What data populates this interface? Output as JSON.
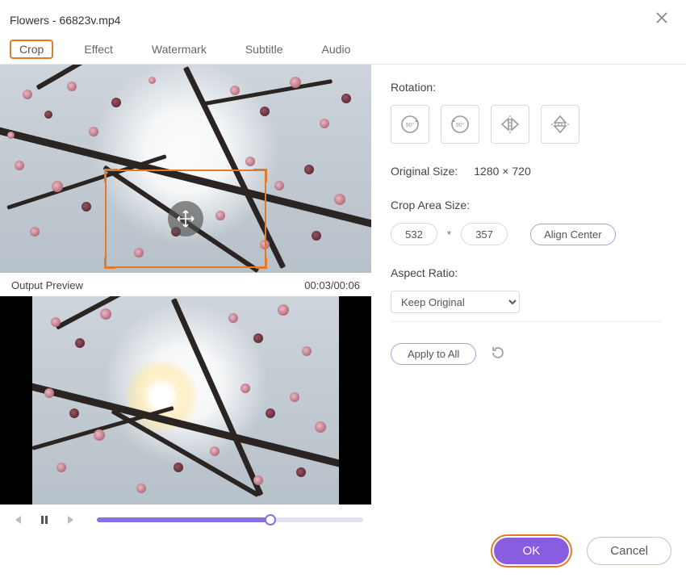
{
  "title": "Flowers - 66823v.mp4",
  "tabs": [
    "Crop",
    "Effect",
    "Watermark",
    "Subtitle",
    "Audio"
  ],
  "active_tab": 0,
  "rotation_label": "Rotation:",
  "original_size_label": "Original Size:",
  "original_size_value": "1280 × 720",
  "crop_area_label": "Crop Area Size:",
  "crop_w": "532",
  "crop_h": "357",
  "crop_sep": "*",
  "align_center": "Align Center",
  "aspect_ratio_label": "Aspect Ratio:",
  "aspect_ratio_value": "Keep Original",
  "apply_all": "Apply to All",
  "preview_label": "Output Preview",
  "time_current": "00:03",
  "time_total": "00:06",
  "time_sep": "/",
  "ok": "OK",
  "cancel": "Cancel",
  "progress_percent": 65,
  "icons": {
    "rotate_cw": "rotate-cw-90-icon",
    "rotate_ccw": "rotate-ccw-90-icon",
    "flip_h": "flip-horizontal-icon",
    "flip_v": "flip-vertical-icon",
    "reset": "reset-icon",
    "prev": "prev-frame-icon",
    "pause": "pause-icon",
    "next": "next-frame-icon",
    "close": "close-icon",
    "move": "move-icon"
  }
}
